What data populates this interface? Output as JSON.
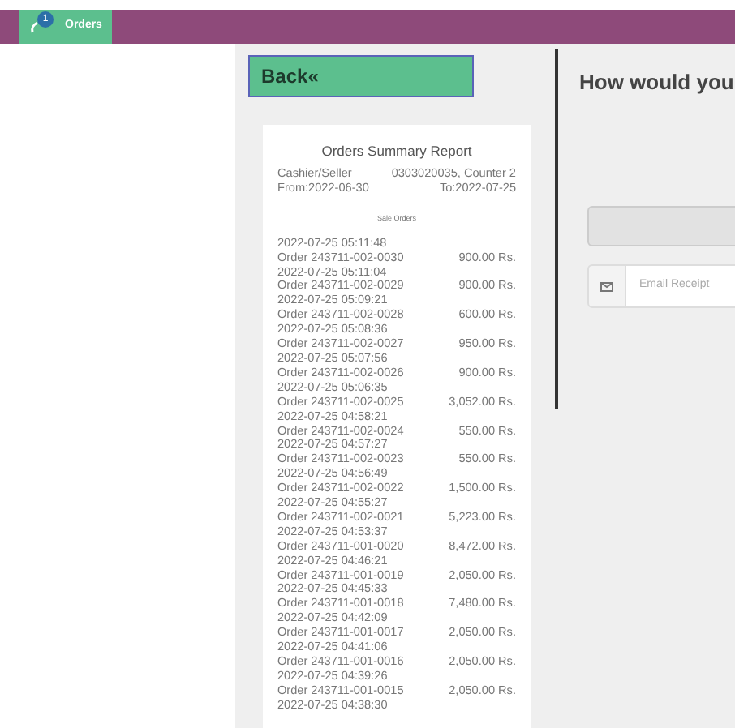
{
  "topbar": {
    "tab": {
      "label": "Orders",
      "badge": "1",
      "selected": true
    }
  },
  "back_button": "Back«",
  "report": {
    "title": "Orders Summary Report",
    "cashier_label": "Cashier/Seller",
    "cashier_value": "0303020035, Counter 2",
    "from": "From:2022-06-30",
    "to": "To:2022-07-25",
    "section": "Sale Orders",
    "orders": [
      {
        "time": "2022-07-25 05:11:48",
        "order": "Order 243711-002-0030",
        "amount": "900.00 Rs."
      },
      {
        "time": "2022-07-25 05:11:04",
        "order": "Order 243711-002-0029",
        "amount": "900.00 Rs."
      },
      {
        "time": "2022-07-25 05:09:21",
        "order": "Order 243711-002-0028",
        "amount": "600.00 Rs."
      },
      {
        "time": "2022-07-25 05:08:36",
        "order": "Order 243711-002-0027",
        "amount": "950.00 Rs."
      },
      {
        "time": "2022-07-25 05:07:56",
        "order": "Order 243711-002-0026",
        "amount": "900.00 Rs."
      },
      {
        "time": "2022-07-25 05:06:35",
        "order": "Order 243711-002-0025",
        "amount": "3,052.00 Rs."
      },
      {
        "time": "2022-07-25 04:58:21",
        "order": "Order 243711-002-0024",
        "amount": "550.00 Rs."
      },
      {
        "time": "2022-07-25 04:57:27",
        "order": "Order 243711-002-0023",
        "amount": "550.00 Rs."
      },
      {
        "time": "2022-07-25 04:56:49",
        "order": "Order 243711-002-0022",
        "amount": "1,500.00 Rs."
      },
      {
        "time": "2022-07-25 04:55:27",
        "order": "Order 243711-002-0021",
        "amount": "5,223.00 Rs."
      },
      {
        "time": "2022-07-25 04:53:37",
        "order": "Order 243711-001-0020",
        "amount": "8,472.00 Rs."
      },
      {
        "time": "2022-07-25 04:46:21",
        "order": "Order 243711-001-0019",
        "amount": "2,050.00 Rs."
      },
      {
        "time": "2022-07-25 04:45:33",
        "order": "Order 243711-001-0018",
        "amount": "7,480.00 Rs."
      },
      {
        "time": "2022-07-25 04:42:09",
        "order": "Order 243711-001-0017",
        "amount": "2,050.00 Rs."
      },
      {
        "time": "2022-07-25 04:41:06",
        "order": "Order 243711-001-0016",
        "amount": "2,050.00 Rs."
      },
      {
        "time": "2022-07-25 04:39:26",
        "order": "Order 243711-001-0015",
        "amount": "2,050.00 Rs."
      },
      {
        "time": "2022-07-25 04:38:30"
      }
    ]
  },
  "receipt_panel": {
    "heading": "How would you",
    "email_placeholder": "Email Receipt"
  }
}
